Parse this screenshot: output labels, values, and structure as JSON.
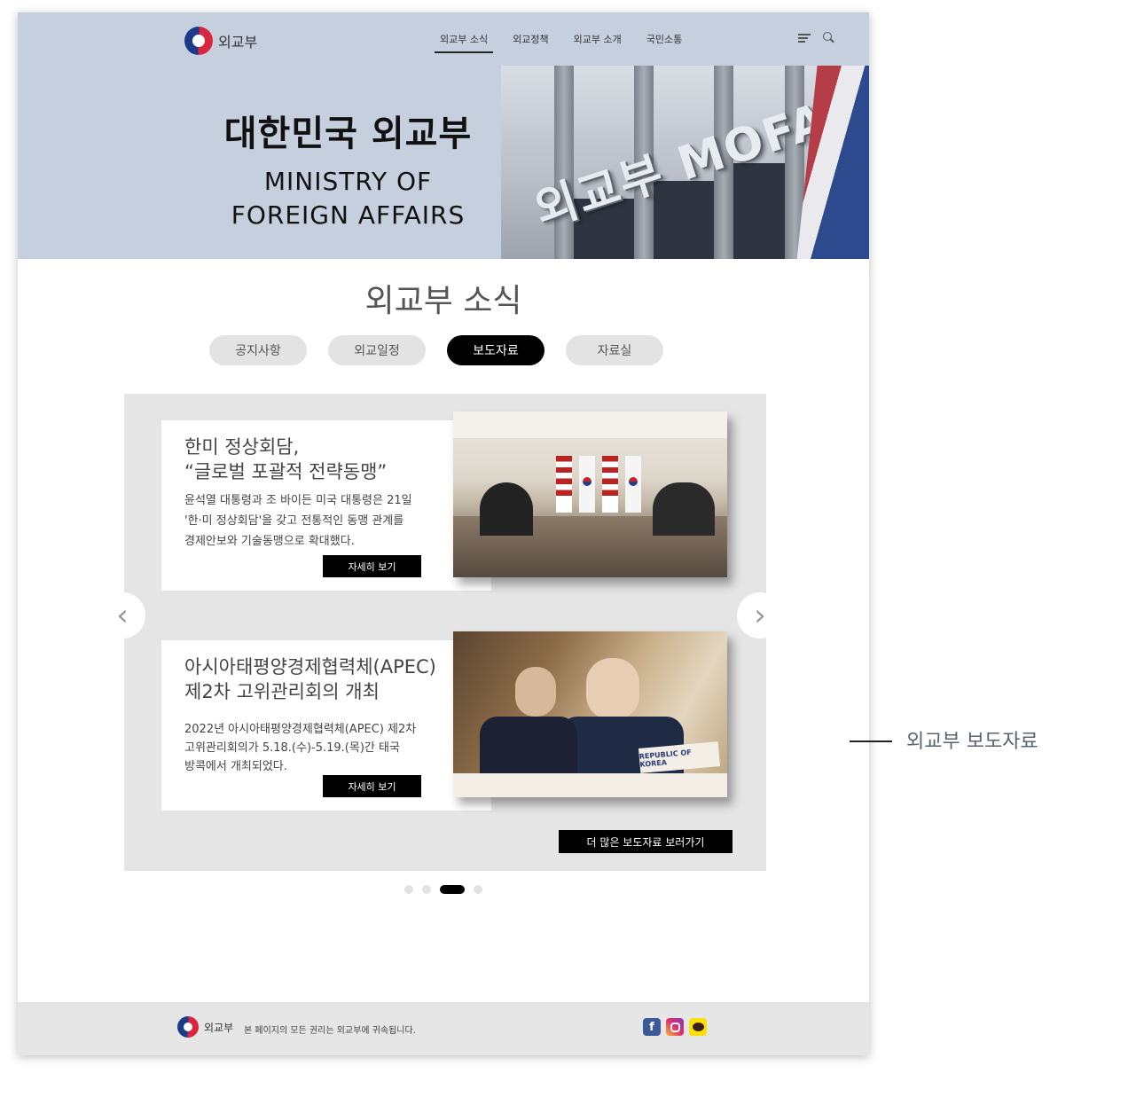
{
  "header": {
    "logo_text": "외교부",
    "nav": [
      "외교부 소식",
      "외교정책",
      "외교부 소개",
      "국민소통"
    ],
    "icons": [
      "menu-icon",
      "search-icon"
    ]
  },
  "hero": {
    "title_kr": "대한민국 외교부",
    "title_en_line1": "MINISTRY OF",
    "title_en_line2": "FOREIGN AFFAIRS",
    "sign_text": "외교부 MOFA"
  },
  "section": {
    "title": "외교부 소식",
    "tabs": [
      "공지사항",
      "외교일정",
      "보도자료",
      "자료실"
    ],
    "active_tab": "보도자료"
  },
  "cards": [
    {
      "title_line1": "한미 정상회담,",
      "title_line2": "“글로벌 포괄적 전략동맹”",
      "body_line1": "윤석열 대통령과 조 바이든 미국 대통령은 21일",
      "body_line2": "'한·미 정상회담'을 갖고 전통적인 동맹 관계를",
      "body_line3": "경제안보와 기술동맹으로 확대했다.",
      "button": "자세히 보기"
    },
    {
      "title_line1": "아시아태평양경제협력체(APEC)",
      "title_line2": "제2차 고위관리회의 개최",
      "body_line1": "2022년 아시아태평양경제협력체(APEC) 제2차",
      "body_line2": "고위관리회의가 5.18.(수)-5.19.(목)간 태국",
      "body_line3": "방콕에서 개최되었다.",
      "button": "자세히 보기",
      "photo_sign": "REPUBLIC OF KOREA"
    }
  ],
  "more_button": "더 많은 보도자료 보러가기",
  "carousel": {
    "prev_icon": "chevron-left-icon",
    "next_icon": "chevron-right-icon",
    "pages": 4,
    "active_page": 3
  },
  "footer": {
    "logo_text": "외교부",
    "copyright": "본 페이지의 모든 권리는 외교부에 귀속됩니다.",
    "social": [
      "facebook-icon",
      "instagram-icon",
      "kakaotalk-icon"
    ]
  },
  "annotation": "외교부 보도자료",
  "colors": {
    "hero_bg": "#c6cfde",
    "carousel_bg": "#e5e5e5",
    "footer_bg": "#e6e6e6",
    "accent": "#000000"
  }
}
